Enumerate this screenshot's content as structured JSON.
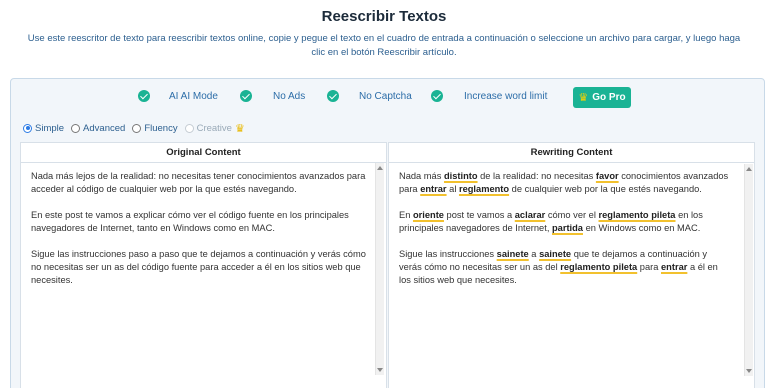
{
  "title": "Reescribir Textos",
  "description": "Use este reescritor de texto para reescribir textos online, copie y pegue el texto en el cuadro de entrada a continuación o seleccione un archivo para cargar, y luego haga clic en el botón Reescribir artículo.",
  "features": [
    {
      "label": "AI AI Mode",
      "icon": "check-circle-icon"
    },
    {
      "label": "No Ads",
      "icon": "check-circle-icon"
    },
    {
      "label": "No Captcha",
      "icon": "check-circle-icon"
    },
    {
      "label": "Increase word limit",
      "icon": "check-circle-icon"
    }
  ],
  "go_pro": {
    "label": "Go Pro",
    "icon": "crown-icon",
    "icon_glyph": "♛"
  },
  "modes": [
    {
      "label": "Simple",
      "selected": true
    },
    {
      "label": "Advanced",
      "selected": false
    },
    {
      "label": "Fluency",
      "selected": false
    },
    {
      "label": "Creative",
      "selected": false,
      "disabled": true
    }
  ],
  "creative_crown": "♛",
  "original": {
    "header": "Original Content",
    "paragraphs": [
      "Nada más lejos de la realidad: no necesitas tener conocimientos avanzados para acceder al código de cualquier web por la que estés navegando.",
      "En este post te vamos a explicar cómo ver el código fuente en los principales navegadores de Internet, tanto en Windows como en MAC.",
      "Sigue las instrucciones paso a paso que te dejamos a continuación y verás cómo no necesitas ser un as del código fuente para acceder a él en los sitios web que necesites."
    ]
  },
  "rewritten": {
    "header": "Rewriting Content",
    "highlight_color": "#f2c12e",
    "paragraphs": [
      [
        {
          "t": "Nada más "
        },
        {
          "t": "distinto",
          "hl": true
        },
        {
          "t": " de la realidad: no necesitas "
        },
        {
          "t": "favor",
          "hl": true
        },
        {
          "t": " conocimientos avanzados para "
        },
        {
          "t": "entrar",
          "hl": true
        },
        {
          "t": " al "
        },
        {
          "t": "reglamento",
          "hl": true
        },
        {
          "t": " de cualquier web por la que estés navegando."
        }
      ],
      [
        {
          "t": "En "
        },
        {
          "t": "oriente",
          "hl": true
        },
        {
          "t": " post te vamos a "
        },
        {
          "t": "aclarar",
          "hl": true
        },
        {
          "t": " cómo ver el "
        },
        {
          "t": "reglamento pileta",
          "hl": true
        },
        {
          "t": " en los principales navegadores de Internet, "
        },
        {
          "t": "partida",
          "hl": true
        },
        {
          "t": " en Windows como en MAC."
        }
      ],
      [
        {
          "t": "Sigue las instrucciones "
        },
        {
          "t": "sainete",
          "hl": true
        },
        {
          "t": " a "
        },
        {
          "t": "sainete",
          "hl": true
        },
        {
          "t": " que te dejamos a continuación y verás cómo no necesitas ser un as del "
        },
        {
          "t": "reglamento pileta",
          "hl": true
        },
        {
          "t": " para "
        },
        {
          "t": "entrar",
          "hl": true
        },
        {
          "t": " a él en los sitios web que necesites."
        }
      ]
    ]
  }
}
